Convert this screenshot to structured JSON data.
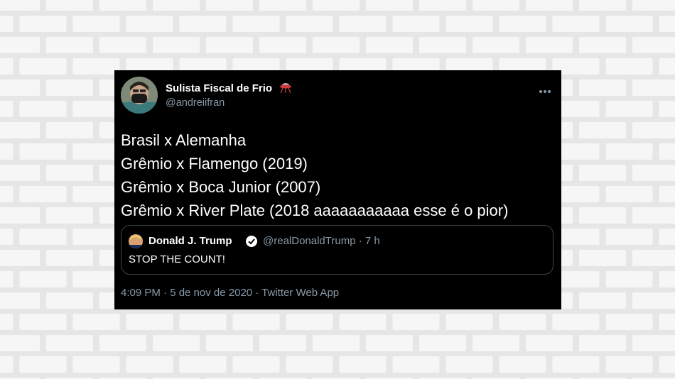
{
  "tweet": {
    "author": {
      "name": "Sulista Fiscal de Frio",
      "handle": "@andreiifran",
      "name_emoji": "flying-saucer-icon"
    },
    "lines": [
      "Brasil x Alemanha",
      "Grêmio x Flamengo (2019)",
      "Grêmio x Boca Junior (2007)",
      "Grêmio x River Plate (2018 aaaaaaaaaaa esse é o pior)"
    ],
    "quoted": {
      "name": "Donald J. Trump",
      "handle": "@realDonaldTrump · 7 h",
      "text": "STOP THE COUNT!",
      "verified": true
    },
    "meta": "4:09 PM · 5 de nov de 2020 · Twitter Web App"
  },
  "colors": {
    "background_wall": "#e6e6e6",
    "brick": "#f6f6f6",
    "card": "#000000",
    "secondary_text": "#8899a6",
    "quote_border": "#38444d"
  }
}
